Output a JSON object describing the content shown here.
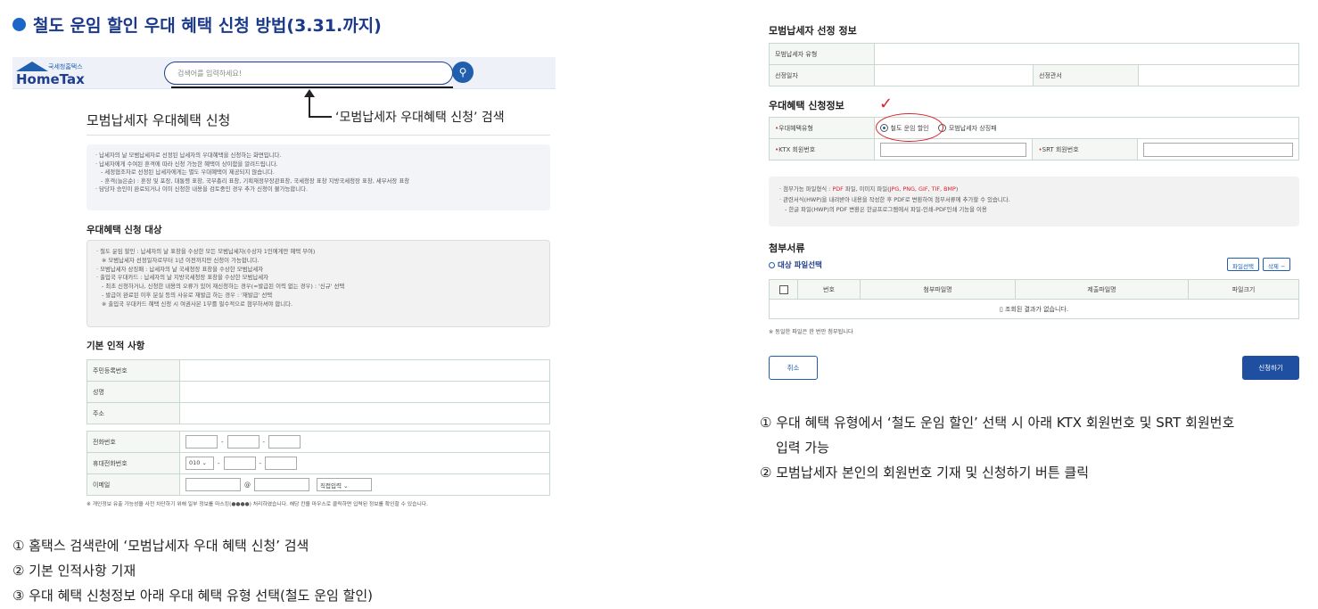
{
  "heading": "철도 운임 할인 우대 혜택 신청 방법(3.31.까지)",
  "hometax": {
    "logo_small": "국세청홈택스",
    "logo_big": "HomeTax",
    "search_placeholder": "검색어를 입력하세요!",
    "search_icon": "search-icon"
  },
  "annotation": "‘모범납세자 우대혜택 신청’ 검색",
  "left_page": {
    "title": "모범납세자 우대혜택 신청",
    "info_lines": [
      "· 납세자의 날 모범납세자로 선정된 납세자의 우대혜택을 신청하는 화면입니다.",
      "· 납세자에게 수여된 훈격에 따라 신청 가능한 혜택이 상이함을 알려드립니다.",
      "  - 세정협조자로 선정된 납세자에게는 별도 우대혜택이 제공되지 않습니다.",
      "  - 훈격(늘은순) : 훈장 및 포장, 대통령 표창, 국무총리 표창, 기획재정부장관표창, 국세청장 표창 지방국세청장 표창, 세무서장 표창",
      "· 담당자 승인이 완료되거나 이미 신청한 내용을 검토중인 경우 추가 신청이 불가능합니다."
    ],
    "target_heading": "우대혜택 신청 대상",
    "target_lines": [
      "· 철도 운임 할인 : 납세자의 날 표창을 수상한 모든 모범납세자(수상자 1인에게만 혜택 부여)",
      "  ※ 모범납세자 선정일자로부터 1년 이전까지만 신청이 가능합니다.",
      "· 모범납세자 상징패 : 납세자의 날 국세청장 표창을 수상한 모범납세자",
      "· 출입국 우대카드 : 납세자의 날 지방국세청장 표창을 수상한 모범납세자",
      "  - 최초 신청하거나, 신청한 내용의 오류가 있어 재신청하는 경우(=발급된 이력 없는 경우) : '신규' 선택",
      "  - 발급이 완료된 이후 분실 등의 사유로 재발급 하는 경우 : '재발급' 선택",
      "  ※ 출입국 우대카드 혜택 신청 시 여권사본 1부를 필수적으로 첨부하셔야 합니다."
    ],
    "basic_heading": "기본 인적 사항",
    "basic_rows": [
      "주민등록번호",
      "성명",
      "주소"
    ],
    "contact": {
      "phone_label": "전화번호",
      "mobile_label": "휴대전화번호",
      "mobile_prefix": "010",
      "email_label": "이메일",
      "email_domain_select": "직접입력",
      "dash": "-",
      "at": "@",
      "chevron": "⌄"
    },
    "privacy_note": "※ 개인정보 유출 가능성을 사전 차단하기 위해 일부 정보를 마스킹(●●●●) 처리하였습니다. 해당 칸을 마우스로 클릭하면 입력된 정보를 확인할 수 있습니다."
  },
  "left_steps": [
    "① 홈택스 검색란에 ‘모범납세자 우대 혜택 신청’ 검색",
    "② 기본 인적사항 기재",
    "③ 우대 혜택 신청정보 아래 우대 혜택 유형 선택(철도 운임 할인)"
  ],
  "right_page": {
    "selection_heading": "모범납세자 선정 정보",
    "selection_type_label": "모범납세자 유형",
    "selection_date_label": "선정일자",
    "selection_office_label": "선정관서",
    "benefit_heading": "우대혜택 신청정보",
    "benefit_type_label": "우대혜택유형",
    "option_rail": "철도 운임 할인",
    "option_plaque": "모범납세자 상징패",
    "ktx_label": "KTX 회원번호",
    "srt_label": "SRT 회원번호",
    "required_mark": "•",
    "check_mark": "✓",
    "info_line1_prefix": "· 첨부가능 파일형식 : ",
    "info_line1_pdf": "PDF",
    "info_line1_mid": " 파일, 이미지 파일(",
    "info_line1_types": "JPG, PNG, GIF, TIF, BMP",
    "info_line1_suffix": ")",
    "info_line2": "· 관련서식(HWP)을 내려받아 내용을 작성한 후 PDF로 변환하여 첨부서류에 추가할 수 있습니다.",
    "info_line3": "  - 한글 파일(HWP)의 PDF 변환은 한글프로그램에서 파일-인쇄-PDF인쇄 기능을 이용",
    "attach_heading": "첨부서류",
    "attach_sub": "대상 파일선택",
    "file_select_btn": "파일선택",
    "delete_btn": "삭제 −",
    "file_cols": [
      "번호",
      "첨부파일명",
      "제출파일명",
      "파일크기"
    ],
    "no_result": "조회된 결과가 없습니다.",
    "file_note": "※ 동일한 파일은 한 번만 첨부됩니다",
    "cancel_btn": "취소",
    "apply_btn": "신청하기"
  },
  "right_steps": [
    "① 우대 혜택 유형에서 ‘철도 운임 할인’ 선택 시 아래 KTX 회원번호 및 SRT 회원번호",
    "   입력 가능",
    "② 모범납세자 본인의 회원번호 기재 및 신청하기 버튼 클릭"
  ]
}
